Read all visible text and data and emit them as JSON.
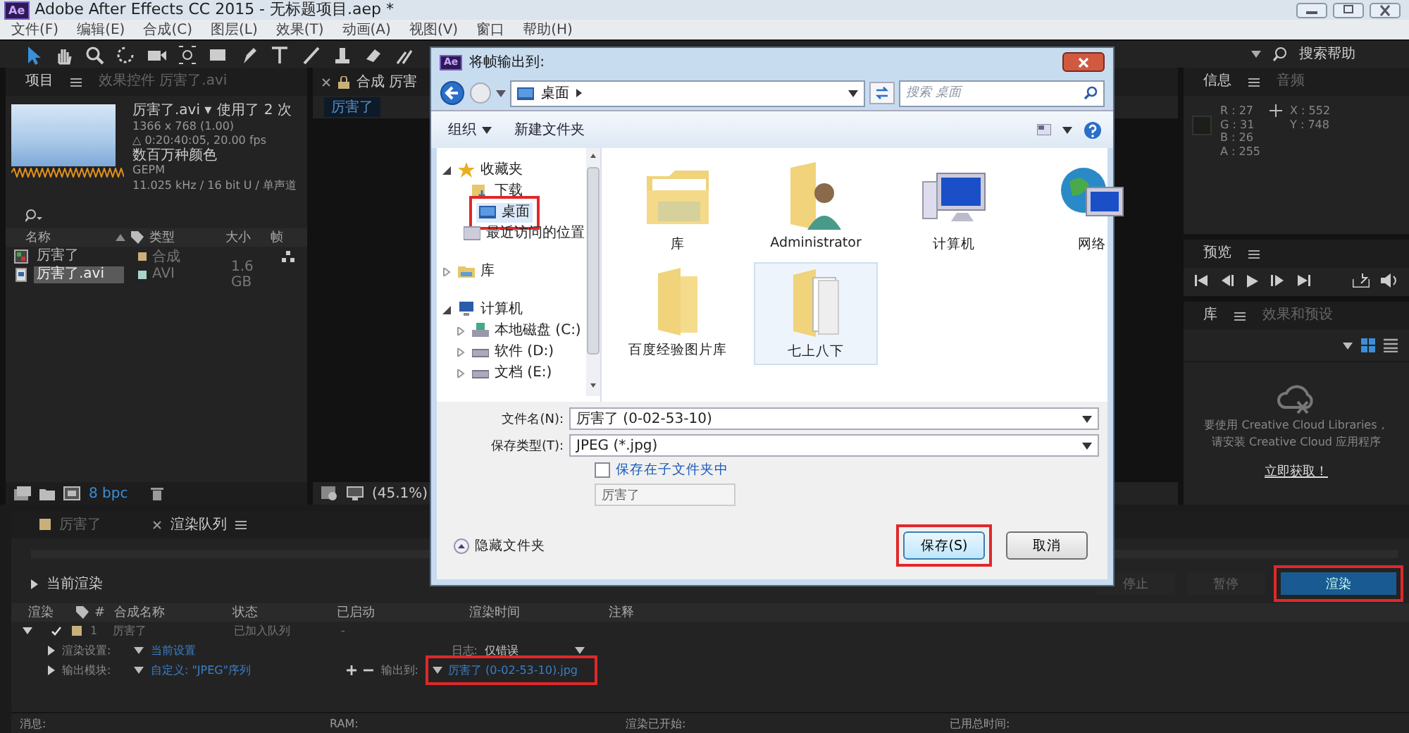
{
  "window": {
    "app_badge": "Ae",
    "title": "Adobe After Effects CC 2015 - 无标题项目.aep *"
  },
  "menu": [
    "文件(F)",
    "编辑(E)",
    "合成(C)",
    "图层(L)",
    "效果(T)",
    "动画(A)",
    "视图(V)",
    "窗口",
    "帮助(H)"
  ],
  "toolbar": {
    "search_placeholder": "搜索帮助"
  },
  "project_panel": {
    "tabs": [
      {
        "label": "项目",
        "selected": true
      },
      {
        "label": "效果控件 厉害了.avi",
        "selected": false
      }
    ],
    "footage": {
      "name": "厉害了.avi ▾",
      "usage": "使用了 2 次",
      "details": [
        "1366 x 768 (1.00)",
        "△ 0:20:40:05, 20.00 fps",
        "数百万种颜色",
        "GEPM",
        "11.025 kHz / 16 bit U / 单声道"
      ]
    },
    "columns": [
      "名称",
      "类型",
      "大小",
      "帧"
    ],
    "items": [
      {
        "name": "厉害了",
        "kind": "comp",
        "type": "合成",
        "selected": false
      },
      {
        "name": "厉害了.avi",
        "kind": "footage",
        "type": "AVI",
        "size": "1.6 GB",
        "selected": true
      }
    ],
    "bpc": "8 bpc"
  },
  "comp_panel": {
    "tab": "合成 厉害",
    "subtabs": [
      {
        "label": "厉害了",
        "selected": true
      }
    ],
    "zoom": "(45.1%)"
  },
  "info_panel": {
    "tabs": [
      {
        "label": "信息",
        "selected": true
      },
      {
        "label": "音频",
        "selected": false
      }
    ],
    "channel_values": [
      "R : 27",
      "G : 31",
      "B : 26",
      "A : 255"
    ],
    "position": [
      "X : 552",
      "Y : 748"
    ]
  },
  "preview_panel": {
    "title": "预览"
  },
  "library_panel": {
    "tabs": [
      {
        "label": "库",
        "selected": true
      },
      {
        "label": "效果和预设",
        "selected": false
      }
    ],
    "message": [
      "要使用 Creative Cloud Libraries，",
      "请安装 Creative Cloud 应用程序"
    ],
    "link": "立即获取！"
  },
  "render_queue": {
    "tabs": [
      {
        "label": "厉害了",
        "selected": false
      },
      {
        "label": "渲染队列",
        "selected": true
      }
    ],
    "current_render": "当前渲染",
    "buttons": [
      {
        "label": "停止",
        "disabled": true
      },
      {
        "label": "暂停",
        "disabled": true
      },
      {
        "label": "渲染",
        "disabled": false,
        "highlighted": true
      }
    ],
    "columns": [
      "渲染",
      "#",
      "合成名称",
      "状态",
      "已启动",
      "渲染时间",
      "注释"
    ],
    "items": [
      {
        "checked": true,
        "expanded": true,
        "number": "1",
        "comp": "厉害了",
        "status": "已加入队列",
        "started": "-",
        "render_settings": {
          "label": "渲染设置:",
          "value": "当前设置"
        },
        "log": {
          "label": "日志:",
          "value": "仅错误"
        },
        "output_module": {
          "label": "输出模块:",
          "value": "自定义: \"JPEG\"序列"
        },
        "output_to": {
          "label": "输出到:",
          "value": "厉害了 (0-02-53-10).jpg",
          "highlighted": true
        }
      }
    ],
    "status": [
      "消息:",
      "RAM:",
      "渲染已开始:",
      "已用总时间:"
    ]
  },
  "dialog": {
    "app_badge": "Ae",
    "title": "将帧输出到:",
    "path": "桌面",
    "search_placeholder": "搜索 桌面",
    "commands": [
      {
        "label": "组织",
        "kind": "menu"
      },
      {
        "label": "新建文件夹",
        "kind": "plain"
      }
    ],
    "nav": [
      {
        "label": "收藏夹",
        "kind": "favorites",
        "expanded": true,
        "selected": false,
        "children": [
          {
            "label": "下载",
            "kind": "downloads",
            "selected": false
          },
          {
            "label": "桌面",
            "kind": "desktop",
            "selected": true,
            "highlighted": true
          },
          {
            "label": "最近访问的位置",
            "kind": "recent",
            "selected": false
          }
        ]
      },
      {
        "label": "库",
        "kind": "library",
        "expanded": false,
        "selected": false
      },
      {
        "label": "计算机",
        "kind": "computer",
        "expanded": true,
        "selected": false,
        "children": [
          {
            "label": "本地磁盘 (C:)",
            "kind": "drive",
            "expanded": false,
            "selected": false
          },
          {
            "label": "软件 (D:)",
            "kind": "disk",
            "expanded": false,
            "selected": false
          },
          {
            "label": "文档 (E:)",
            "kind": "disk",
            "expanded": false,
            "selected": false
          }
        ]
      }
    ],
    "files": [
      {
        "label": "库",
        "kind": "library",
        "selected": false
      },
      {
        "label": "Administrator",
        "kind": "user",
        "selected": false
      },
      {
        "label": "计算机",
        "kind": "computer",
        "selected": false
      },
      {
        "label": "网络",
        "kind": "network",
        "selected": false
      },
      {
        "label": "百度经验图片库",
        "kind": "folder",
        "selected": false
      },
      {
        "label": "七上八下",
        "kind": "docs",
        "selected": true
      }
    ],
    "file_name": {
      "label": "文件名(N):",
      "value": "厉害了 (0-02-53-10)"
    },
    "save_type": {
      "label": "保存类型(T):",
      "value": "JPEG (*.jpg)"
    },
    "subfolder": {
      "label": "保存在子文件夹中",
      "checked": false
    },
    "subfolder_name": {
      "value": "厉害了",
      "disabled": true
    },
    "hide_folders": "隐藏文件夹",
    "buttons": [
      {
        "label": "保存(S)",
        "kind": "default",
        "highlighted": true
      },
      {
        "label": "取消",
        "kind": "normal"
      }
    ]
  }
}
